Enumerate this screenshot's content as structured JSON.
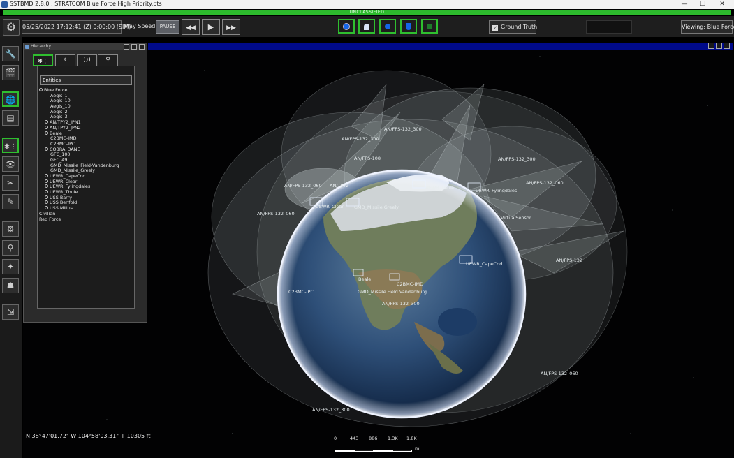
{
  "window": {
    "title": "SSTBMD 2.8.0 : STRATCOM Blue Force High Priority.pts",
    "minimize": "—",
    "maximize": "☐",
    "close": "✕"
  },
  "classification": "UNCLASSIFIED",
  "toolbar": {
    "datetime": "05/25/2022 17:12:41 (Z) 0:00:00 (SIM)",
    "play_speed_label": "Play Speed:",
    "pause_label": "PAUSE",
    "rewind_glyph": "◀◀",
    "play_glyph": "▶",
    "fastforward_glyph": "▶▶",
    "ground_truth_label": "Ground Truth",
    "ground_truth_check": "✓",
    "viewing_label": "Viewing: Blue Force"
  },
  "colors": {
    "accent_green": "#2fbf2f",
    "classification_green": "#2dbb2d",
    "viewport_title_blue": "#000a8a",
    "filter_blue": "#1565e8"
  },
  "panel": {
    "title": "Hierarchy",
    "tabs": [
      "entities-tab",
      "targets-tab",
      "sensors-tab",
      "locations-tab"
    ],
    "tree_header": "Entities",
    "tree": [
      {
        "label": "Blue Force",
        "level": 0,
        "expandable": true
      },
      {
        "label": "Aegis_1",
        "level": 1,
        "expandable": false
      },
      {
        "label": "Aegis_10",
        "level": 1,
        "expandable": false
      },
      {
        "label": "Aegis_10",
        "level": 1,
        "expandable": false
      },
      {
        "label": "Aegis_2",
        "level": 1,
        "expandable": false
      },
      {
        "label": "Aegis_3",
        "level": 1,
        "expandable": false
      },
      {
        "label": "AN/TPY2_JPN1",
        "level": 1,
        "expandable": true
      },
      {
        "label": "AN/TPY2_JPN2",
        "level": 1,
        "expandable": true
      },
      {
        "label": "Beale",
        "level": 1,
        "expandable": true
      },
      {
        "label": "C2BMC-IMD",
        "level": 1,
        "expandable": false
      },
      {
        "label": "C2BMC-IPC",
        "level": 1,
        "expandable": false
      },
      {
        "label": "COBRA_DANE",
        "level": 1,
        "expandable": true
      },
      {
        "label": "GFC_100",
        "level": 1,
        "expandable": false
      },
      {
        "label": "GFC_49",
        "level": 1,
        "expandable": false
      },
      {
        "label": "GMD_Missile_Field-Vandenburg",
        "level": 1,
        "expandable": false
      },
      {
        "label": "GMD_Missile_Greely",
        "level": 1,
        "expandable": false
      },
      {
        "label": "UEWR_CapeCod",
        "level": 1,
        "expandable": true
      },
      {
        "label": "UEWR_Clear",
        "level": 1,
        "expandable": true
      },
      {
        "label": "UEWR_Fylingdales",
        "level": 1,
        "expandable": true
      },
      {
        "label": "UEWR_Thule",
        "level": 1,
        "expandable": true
      },
      {
        "label": "USS Barry",
        "level": 1,
        "expandable": true
      },
      {
        "label": "USS Benfold",
        "level": 1,
        "expandable": true
      },
      {
        "label": "USS Milius",
        "level": 1,
        "expandable": true
      },
      {
        "label": "Civilian",
        "level": 0,
        "expandable": false
      },
      {
        "label": "Red Force",
        "level": 0,
        "expandable": false
      }
    ]
  },
  "map_labels": [
    "AN/FPS-132_300",
    "AN/FPS-132_300",
    "AN/FPS-108",
    "AN/FPS-132_300",
    "AN/FPS-132_060",
    "AN/FPS-132_060",
    "AN/TPY2",
    "AN/FPS-132_060",
    "UEWR_Thule",
    "UEWR_Fylingdales",
    "UEWR_Clear",
    "GMD_Missile Greely",
    "VirtualSensor",
    "UEWR_CapeCod",
    "AN/FPS-132",
    "Beale",
    "C2BMC-IMD",
    "C2BMC-IPC",
    "GMD_Missile Field Vandenburg",
    "AN/FPS-132_300",
    "AN/FPS-132_060",
    "AN/FPS-132_300"
  ],
  "status": {
    "coordinates": "N 38°47'01.72\" W 104°58'03.31\" + 10305 ft"
  },
  "scale_bar": {
    "ticks": [
      "0",
      "443",
      "886",
      "1.3K",
      "1.8K"
    ],
    "unit": "mi"
  }
}
